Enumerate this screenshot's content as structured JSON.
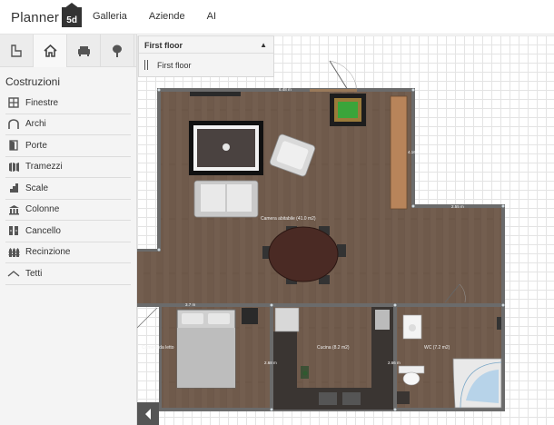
{
  "header": {
    "brand": "Planner",
    "brand_mark": "5d",
    "nav": [
      "Galleria",
      "Aziende",
      "AI"
    ]
  },
  "sidebar": {
    "tabs": [
      "floor-plan-icon",
      "home-icon",
      "sofa-icon",
      "tree-icon"
    ],
    "active_tab": 1,
    "section_title": "Costruzioni",
    "items": [
      {
        "label": "Finestre",
        "icon": "window-icon"
      },
      {
        "label": "Archi",
        "icon": "arch-icon"
      },
      {
        "label": "Porte",
        "icon": "door-icon"
      },
      {
        "label": "Tramezzi",
        "icon": "partition-icon"
      },
      {
        "label": "Scale",
        "icon": "stairs-icon"
      },
      {
        "label": "Colonne",
        "icon": "columns-icon"
      },
      {
        "label": "Cancello",
        "icon": "gate-icon"
      },
      {
        "label": "Recinzione",
        "icon": "fence-icon"
      },
      {
        "label": "Tetti",
        "icon": "roof-icon"
      }
    ]
  },
  "floors": {
    "current": "First floor",
    "list": [
      "First floor"
    ]
  },
  "plan": {
    "rooms": [
      {
        "name": "Camera abitabile (41.0 m2)"
      },
      {
        "name": "Camera da letto"
      },
      {
        "name": "Cucina (8.2 m2)"
      },
      {
        "name": "WC (7.2 m2)"
      }
    ],
    "dimensions": [
      "6.48 m",
      "2.55 m",
      "3.7 m",
      "2.68 m",
      "2.66 m",
      "4.16 m"
    ],
    "wall_color": "#6b6b6b",
    "floor_color": "#6e5848"
  }
}
